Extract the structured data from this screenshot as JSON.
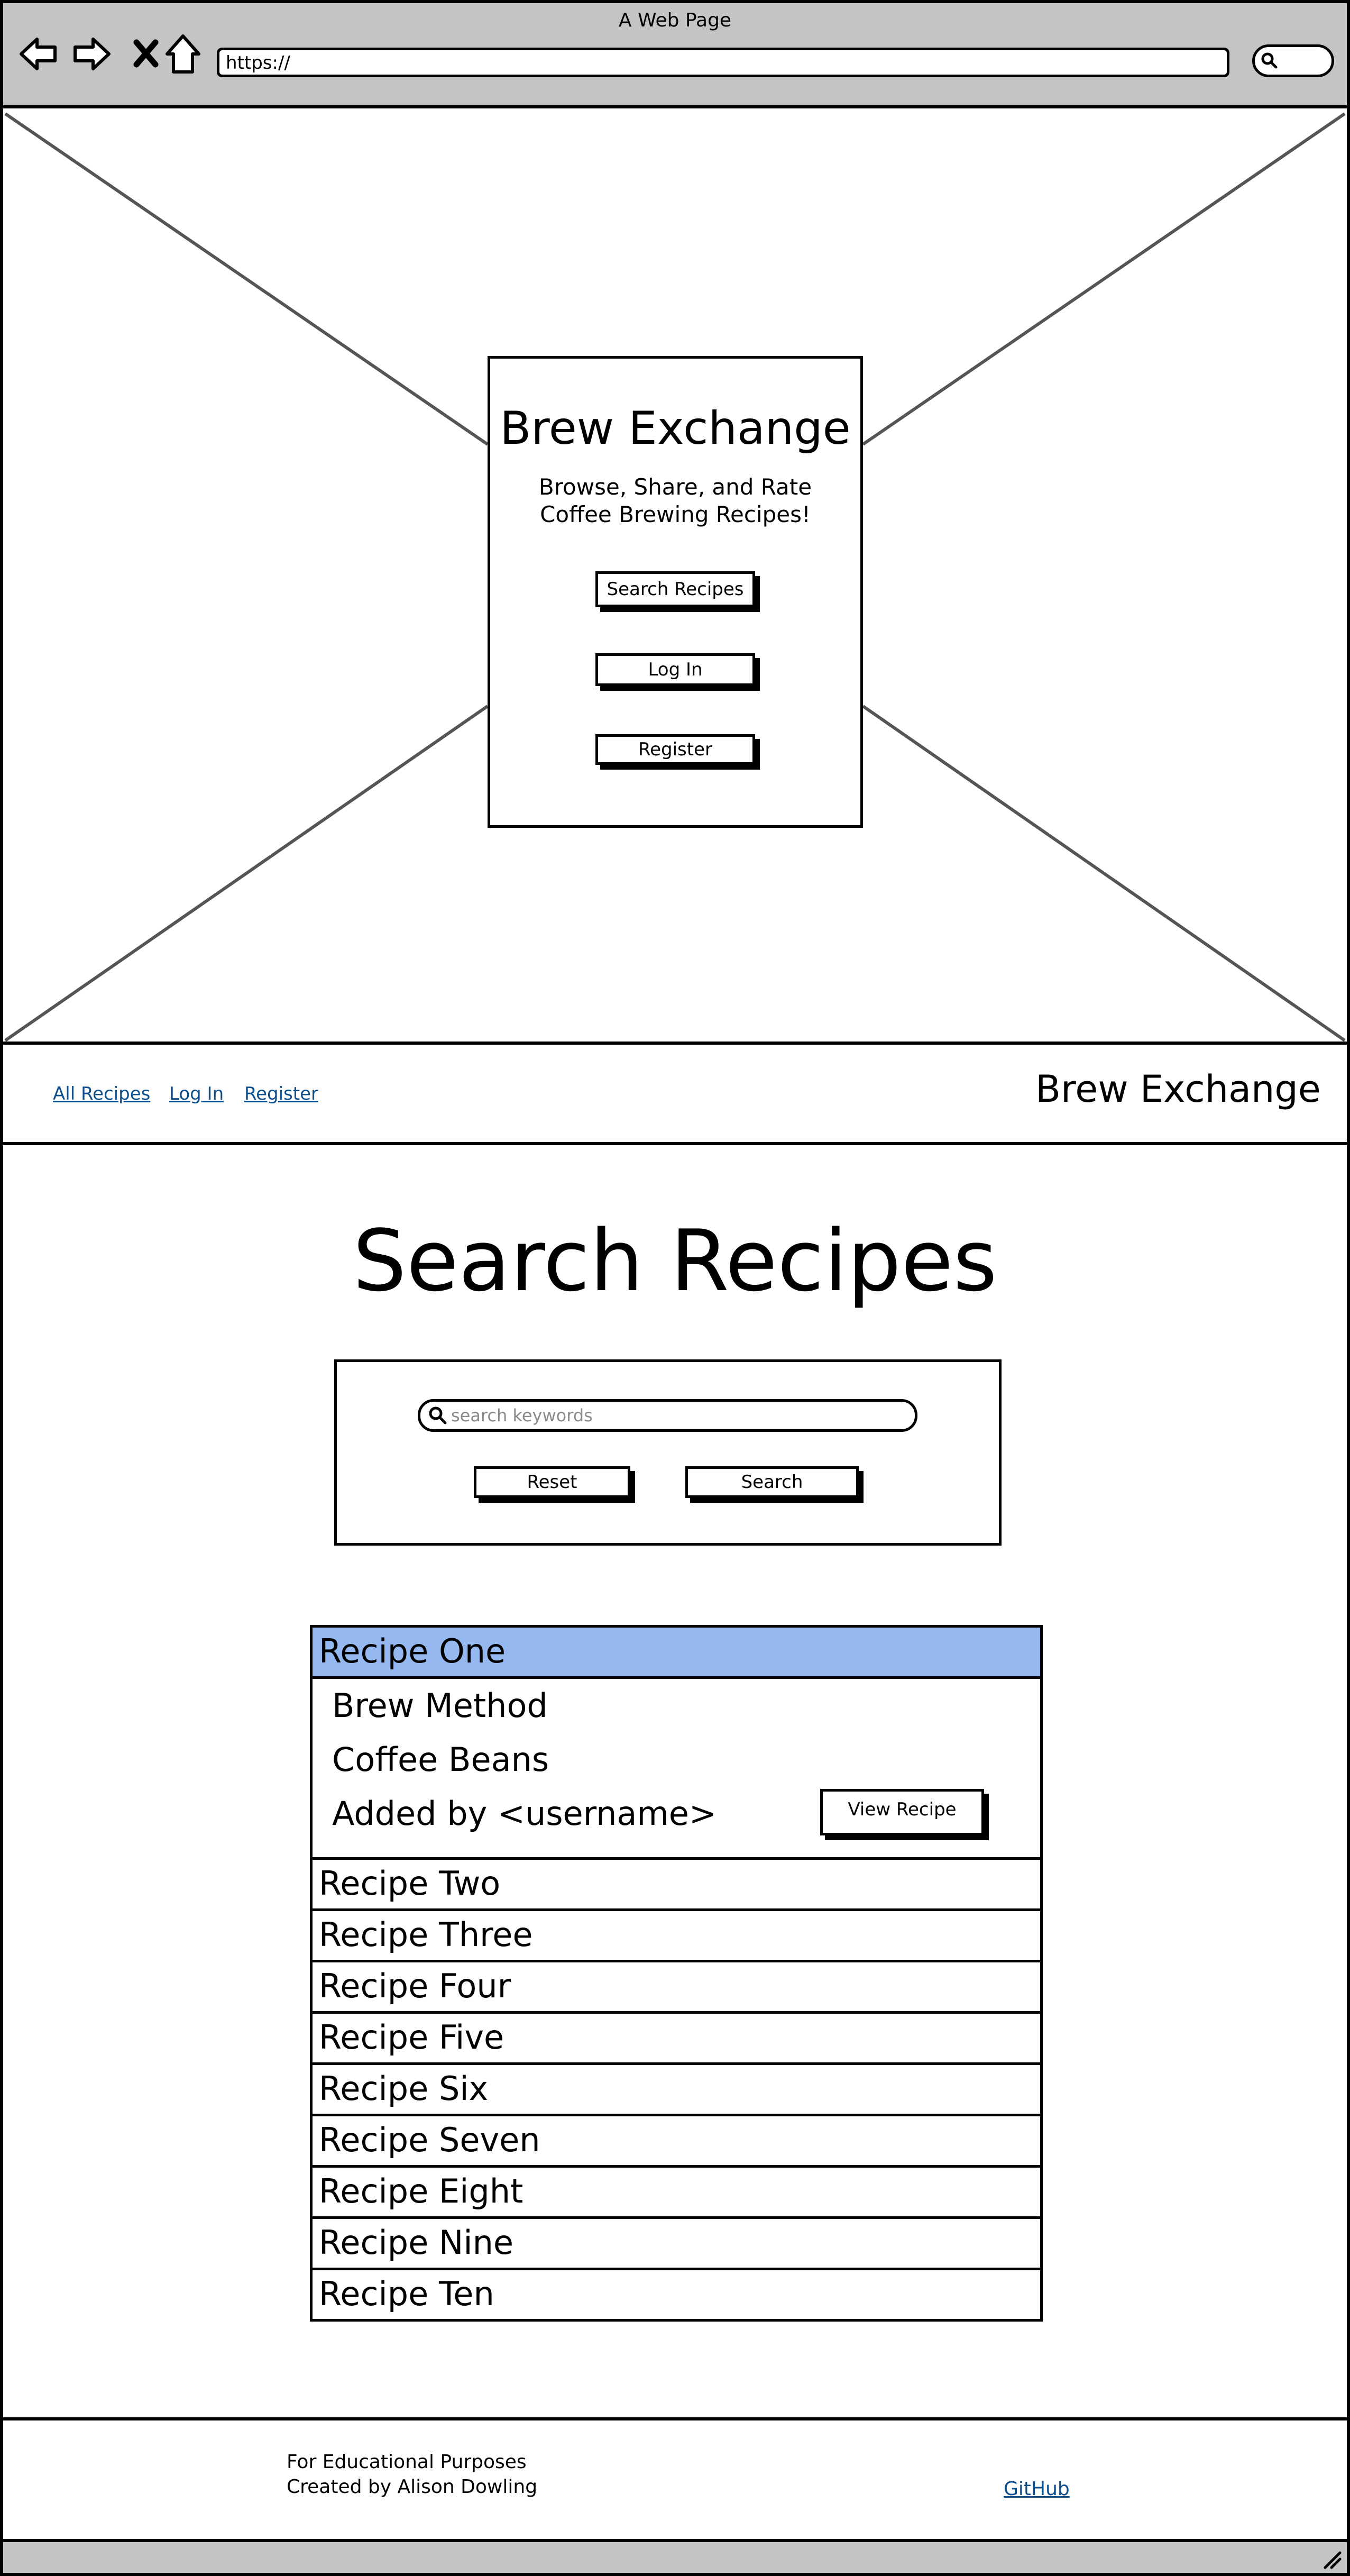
{
  "window": {
    "title": "A Web Page"
  },
  "browser": {
    "url": "https://"
  },
  "hero": {
    "title": "Brew Exchange",
    "tagline_line1": "Browse, Share, and Rate",
    "tagline_line2": "Coffee Brewing Recipes!",
    "buttons": {
      "search": "Search Recipes",
      "login": "Log In",
      "register": "Register"
    }
  },
  "nav": {
    "links": [
      "All Recipes",
      "Log In",
      "Register"
    ],
    "brand": "Brew Exchange"
  },
  "page": {
    "title": "Search Recipes",
    "search": {
      "placeholder": "search keywords",
      "reset_label": "Reset",
      "search_label": "Search"
    }
  },
  "recipes": {
    "items": [
      "Recipe One",
      "Recipe Two",
      "Recipe Three",
      "Recipe Four",
      "Recipe Five",
      "Recipe Six",
      "Recipe Seven",
      "Recipe Eight",
      "Recipe Nine",
      "Recipe Ten"
    ],
    "selected": {
      "brew_method": "Brew Method",
      "coffee_beans": "Coffee Beans",
      "added_by": "Added by <username>",
      "view_label": "View Recipe"
    },
    "selected_color": "#94b8ef"
  },
  "footer": {
    "line1": "For Educational Purposes",
    "line2": "Created by Alison Dowling",
    "github": "GitHub"
  },
  "colors": {
    "chrome": "#c4c4c4",
    "link": "#0b4e8b"
  }
}
